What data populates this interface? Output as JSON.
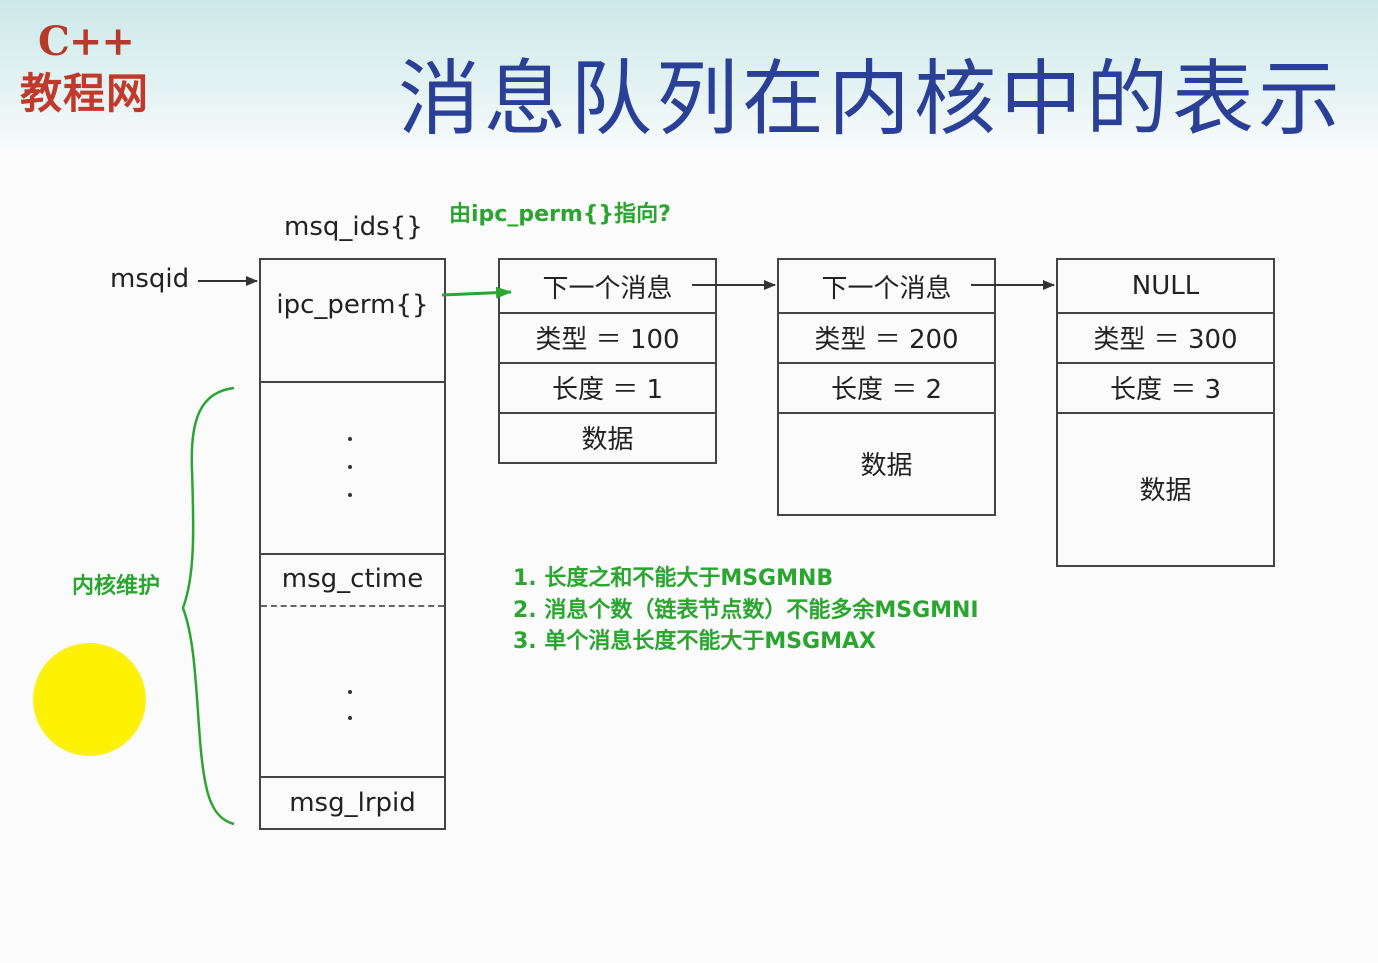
{
  "header": {
    "logo_cpp": "C++",
    "logo_site": "教程网",
    "title": "消息队列在内核中的表示"
  },
  "diagram": {
    "struct_label": "msq_ids{}",
    "msqid_label": "msqid",
    "ipc_perm": "ipc_perm{}",
    "msg_ctime": "msg_ctime",
    "msg_lrpid": "msg_lrpid",
    "messages": [
      {
        "next": "下一个消息",
        "type": "类型 ＝ 100",
        "length": "长度 ＝ 1",
        "data": "数据"
      },
      {
        "next": "下一个消息",
        "type": "类型 ＝ 200",
        "length": "长度 ＝ 2",
        "data": "数据"
      },
      {
        "next": "NULL",
        "type": "类型 ＝ 300",
        "length": "长度 ＝ 3",
        "data": "数据"
      }
    ]
  },
  "annotations": {
    "pointer_note": "由ipc_perm{}指向?",
    "kernel_note": "内核维护",
    "rules": [
      "1. 长度之和不能大于MSGMNB",
      "2. 消息个数（链表节点数）不能多余MSGMNI",
      "3. 单个消息长度不能大于MSGMAX"
    ]
  },
  "colors": {
    "title": "#2a3f96",
    "annotation": "#2aa52f",
    "logo": "#c0392b",
    "highlight_dot": "#fff200"
  }
}
